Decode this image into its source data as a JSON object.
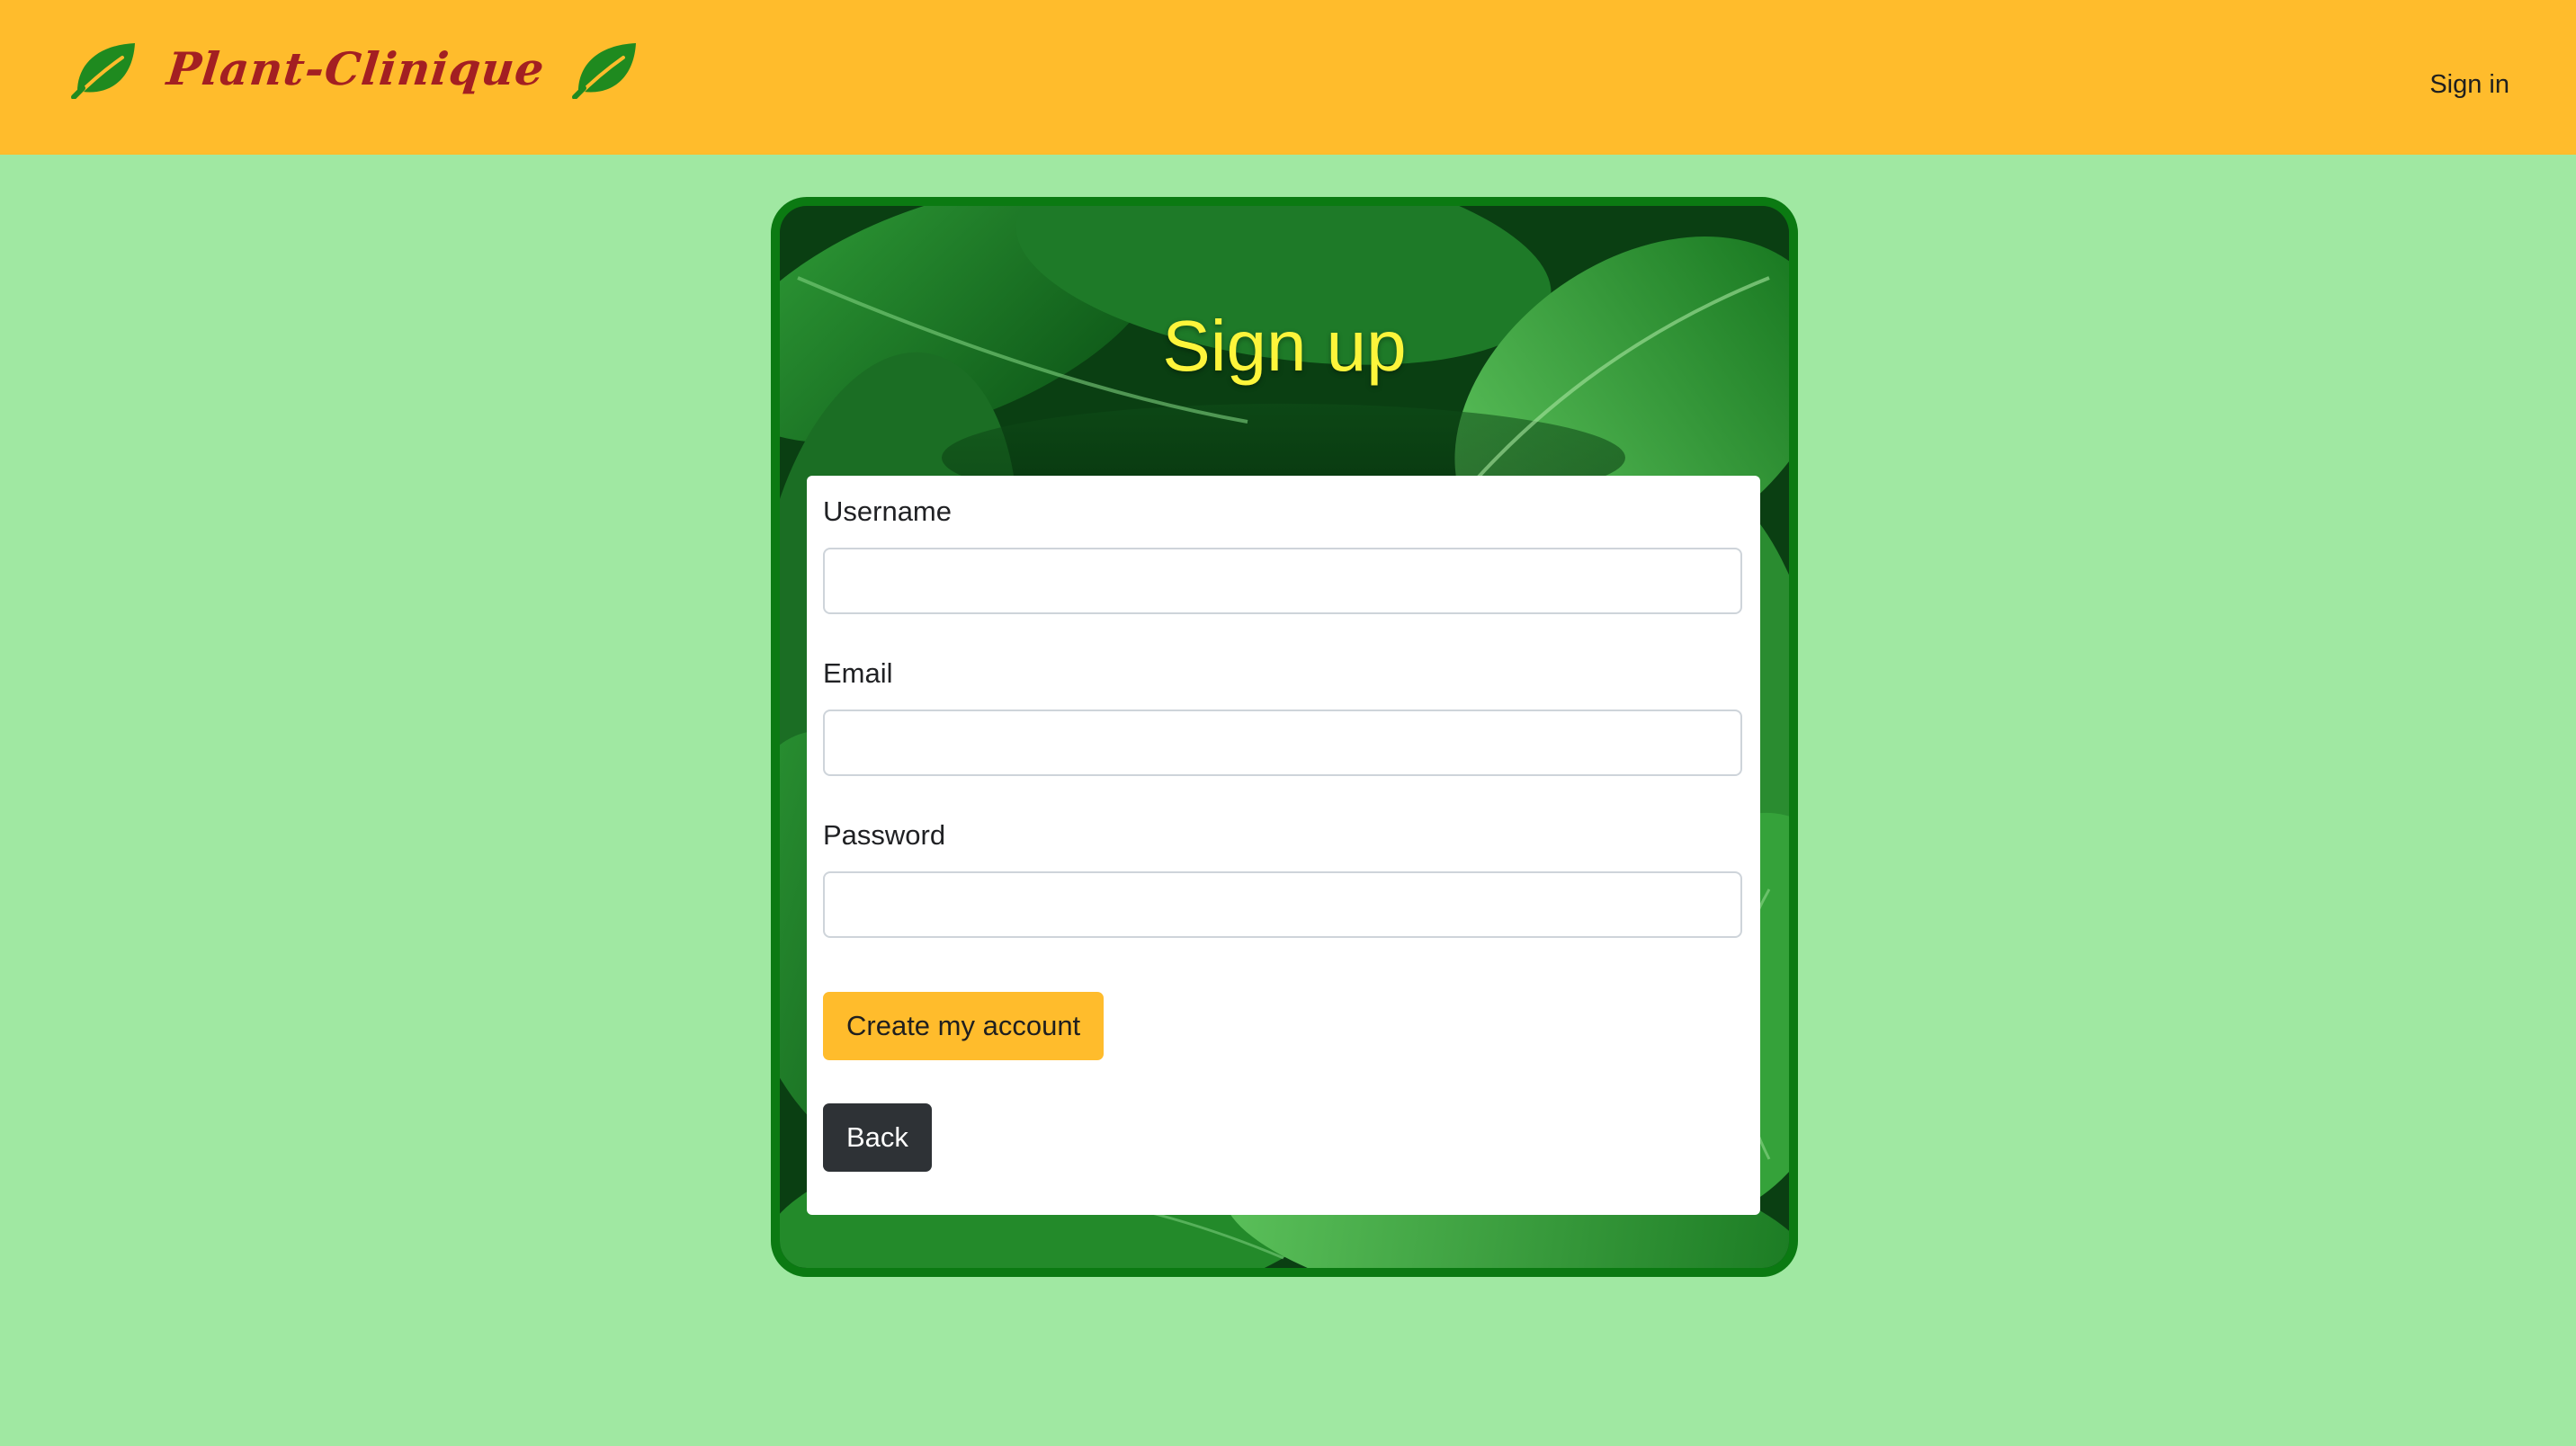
{
  "app": {
    "brand_name": "Plant-Clinique",
    "brand_color": "#a31f22",
    "navbar_color": "#ffbc2c",
    "page_background": "#a0e8a2"
  },
  "nav": {
    "signin_label": "Sign in"
  },
  "signup": {
    "title": "Sign up",
    "title_color": "#fdf53b",
    "card_border_color": "#0b7a12",
    "fields": {
      "username_label": "Username",
      "username_value": "",
      "email_label": "Email",
      "email_value": "",
      "password_label": "Password",
      "password_value": ""
    },
    "create_button_label": "Create my account",
    "back_button_label": "Back",
    "back_button_color": "#2e3236"
  },
  "icons": {
    "brand_left": "leaf-icon",
    "brand_right": "leaf-icon"
  }
}
